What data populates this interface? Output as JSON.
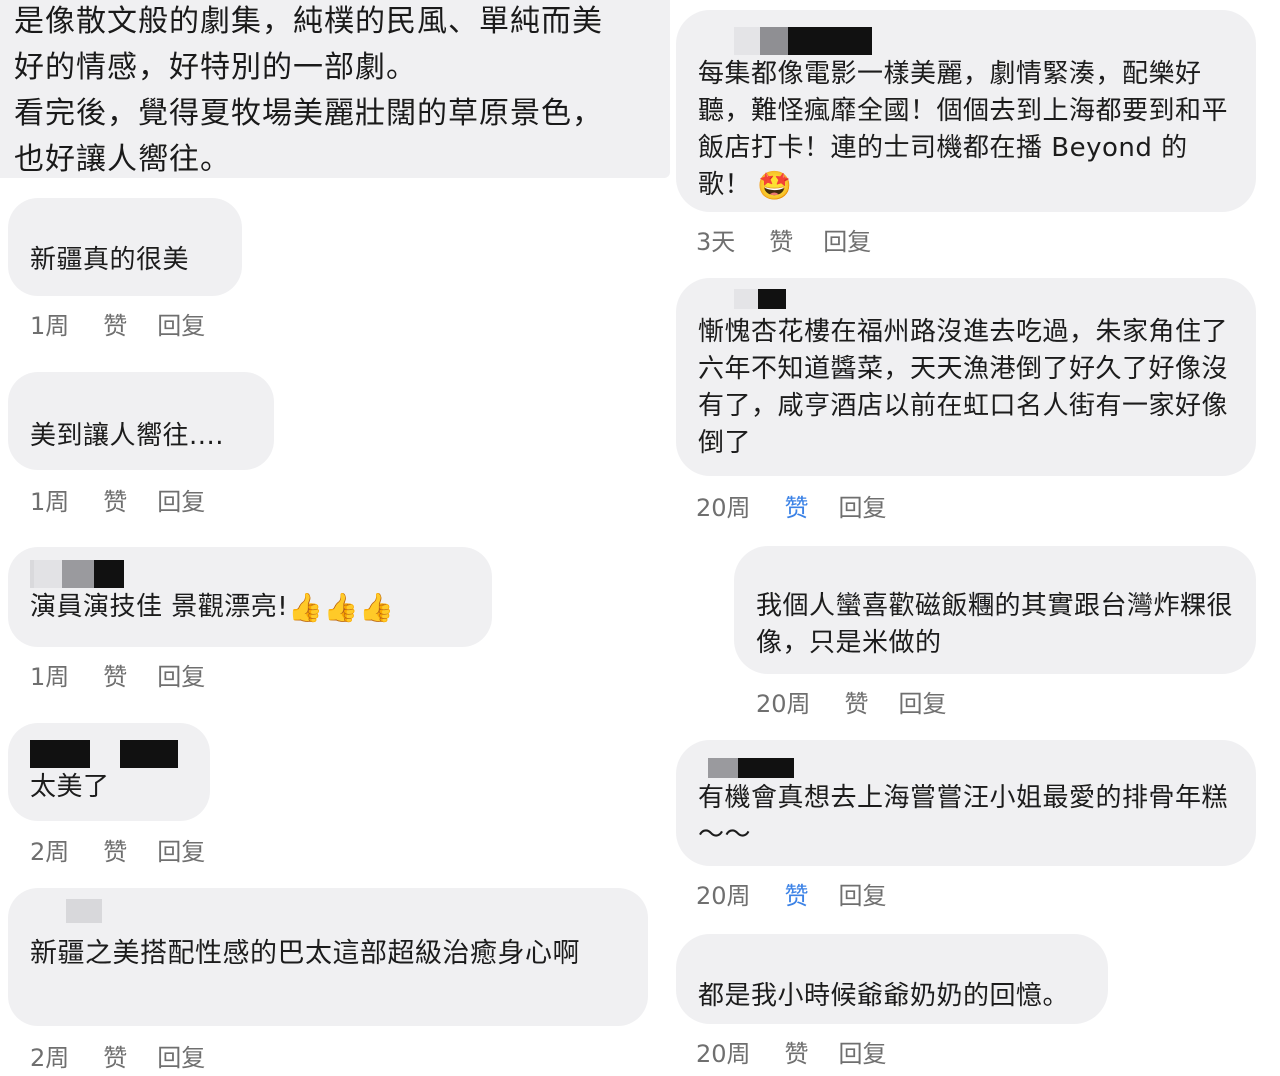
{
  "post": {
    "lines": [
      "是像散文般的劇集，純樸的民風、單純而美",
      "好的情感，好特別的一部劇。",
      "看完後，覺得夏牧場美麗壯闊的草原景色，",
      "也好讓人嚮往。"
    ]
  },
  "labels": {
    "like": "赞",
    "reply": "回复"
  },
  "colors": {
    "bubble_bg": "#f0f0f2",
    "meta_gray": "#6f6f6f",
    "like_active": "#3b82e6"
  },
  "left_comments": [
    {
      "text": "新疆真的很美",
      "time": "1周",
      "liked": false
    },
    {
      "text": "美到讓人嚮往....",
      "time": "1周",
      "liked": false
    },
    {
      "text": "演員演技佳  景觀漂亮!",
      "emojis": [
        "👍",
        "👍",
        "👍"
      ],
      "time": "1周",
      "liked": false
    },
    {
      "text": "太美了",
      "time": "2周",
      "liked": false
    },
    {
      "text": "新疆之美搭配性感的巴太這部超級治癒身心啊",
      "time": "2周",
      "liked": false
    }
  ],
  "right_comments": [
    {
      "text": "每集都像電影一樣美麗，劇情緊湊，配樂好聽，難怪瘋靡全國！個個去到上海都要到和平飯店打卡！連的士司機都在播 Beyond 的歌！",
      "emoji": "🤩",
      "time": "3天",
      "liked": false
    },
    {
      "text": "慚愧杏花樓在福州路沒進去吃過，朱家角住了六年不知道醬菜，天天漁港倒了好久了好像沒有了，咸亨酒店以前在虹口名人街有一家好像倒了",
      "time": "20周",
      "liked": true
    },
    {
      "text": "我個人蠻喜歡磁飯糰的其實跟台灣炸粿很像，只是米做的",
      "time": "20周",
      "liked": false
    },
    {
      "text": "有機會真想去上海嘗嘗汪小姐最愛的排骨年糕～～",
      "time": "20周",
      "liked": true
    },
    {
      "text": "都是我小時候爺爺奶奶的回憶。",
      "time": "20周",
      "liked": false
    }
  ]
}
